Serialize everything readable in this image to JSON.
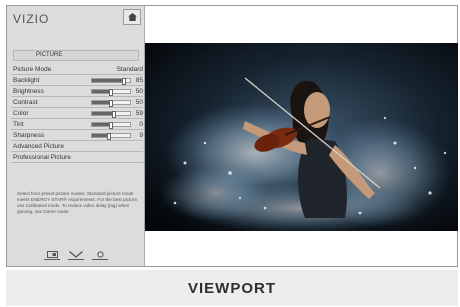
{
  "brand": "VIZIO",
  "menu": {
    "title": "PICTURE",
    "rows": [
      {
        "label": "Picture Mode",
        "value": "Standard",
        "level": null
      },
      {
        "label": "Backlight",
        "value": "85",
        "level": 0.85
      },
      {
        "label": "Brightness",
        "value": "50",
        "level": 0.5
      },
      {
        "label": "Contrast",
        "value": "50",
        "level": 0.5
      },
      {
        "label": "Color",
        "value": "59",
        "level": 0.59
      },
      {
        "label": "Tint",
        "value": "0",
        "level": 0.5
      },
      {
        "label": "Sharpness",
        "value": "9",
        "level": 0.45
      },
      {
        "label": "Advanced Picture",
        "value": "",
        "level": null
      },
      {
        "label": "Professional Picture",
        "value": "",
        "level": null
      }
    ]
  },
  "help_text": "Select from preset picture modes. Standard picture mode meets ENERGY STAR® requirements. For the best picture, use Calibrated mode. To reduce video delay (lag) when gaming, use Game mode.",
  "caption": "VIEWPORT",
  "icons": {
    "home": "home-icon",
    "bottom": [
      "display-icon",
      "chevron-down-icon",
      "circle-icon"
    ]
  },
  "colors": {
    "sidebar_bg": "#dcdcdc",
    "slider_fill": "#666666",
    "caption_bg": "#ededed"
  }
}
